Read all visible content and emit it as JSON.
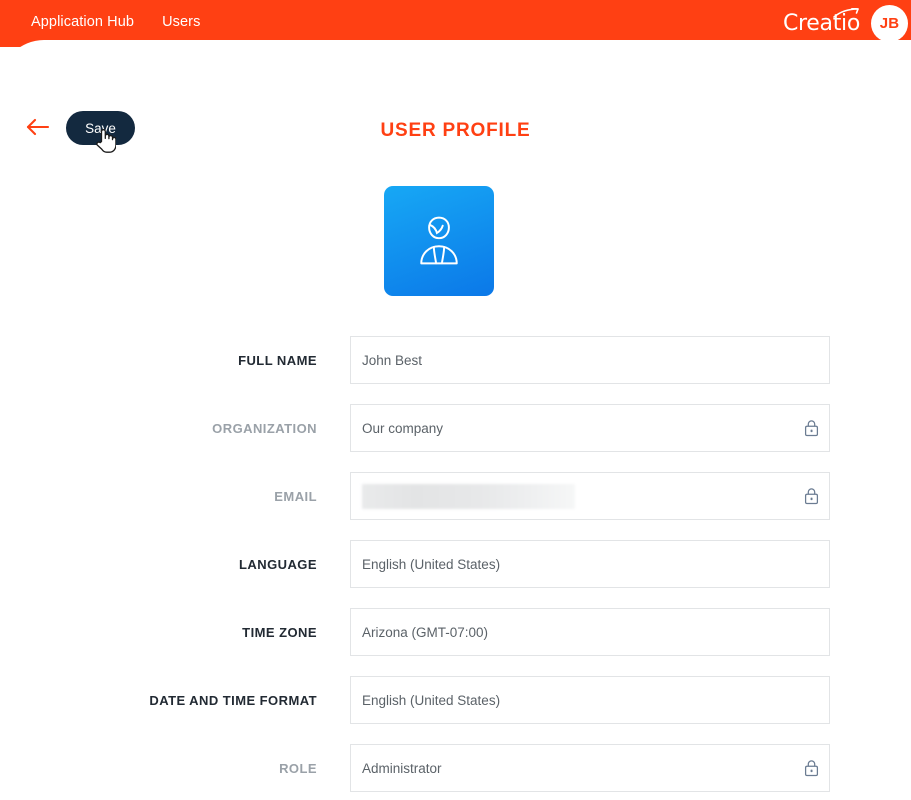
{
  "header": {
    "nav_items": [
      {
        "label": "Application Hub",
        "active": false
      },
      {
        "label": "Users",
        "active": true
      }
    ],
    "brand_name": "Creatio",
    "brand_swoosh_icon": "swoosh-icon",
    "avatar_initials": "JB",
    "bar_color": "#ff4013"
  },
  "toolbar": {
    "back_icon": "arrow-left-icon",
    "save_label": "Save",
    "save_button_color": "#13293f",
    "cursor_icon": "pointer-hand-cursor"
  },
  "page": {
    "title": "USER PROFILE",
    "title_color": "#ff4013"
  },
  "profile_picture": {
    "icon": "user-avatar-icon",
    "gradient_from": "#17a8f5",
    "gradient_to": "#0b78e8"
  },
  "form": {
    "lock_icon": "lock-icon",
    "fields": [
      {
        "label": "FULL NAME",
        "value": "John Best",
        "locked": false,
        "redacted": false
      },
      {
        "label": "ORGANIZATION",
        "value": "Our company",
        "locked": true,
        "redacted": false
      },
      {
        "label": "EMAIL",
        "value": "",
        "locked": true,
        "redacted": true
      },
      {
        "label": "LANGUAGE",
        "value": "English (United States)",
        "locked": false,
        "redacted": false
      },
      {
        "label": "TIME ZONE",
        "value": "Arizona (GMT-07:00)",
        "locked": false,
        "redacted": false
      },
      {
        "label": "DATE AND TIME FORMAT",
        "value": "English (United States)",
        "locked": false,
        "redacted": false
      },
      {
        "label": "ROLE",
        "value": "Administrator",
        "locked": true,
        "redacted": false
      }
    ]
  }
}
